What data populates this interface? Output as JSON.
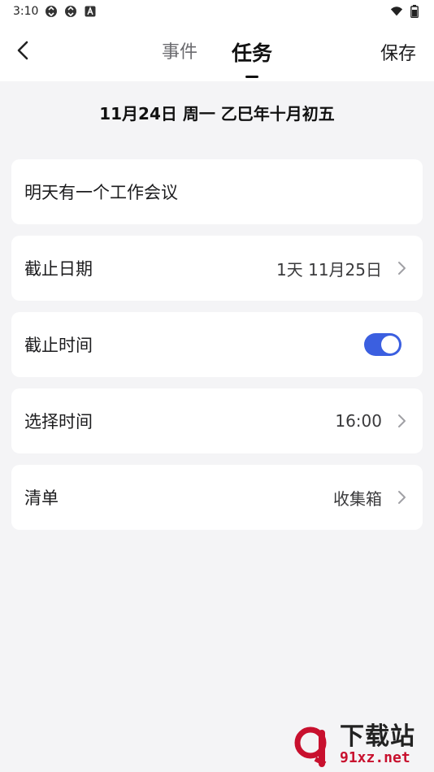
{
  "status_bar": {
    "time": "3:10",
    "icons": [
      "sync-icon",
      "sync-icon",
      "a-icon"
    ],
    "right_icons": [
      "wifi-icon",
      "battery-icon"
    ]
  },
  "header": {
    "tabs": [
      {
        "label": "事件",
        "active": false
      },
      {
        "label": "任务",
        "active": true
      }
    ],
    "save_label": "保存"
  },
  "date_line": "11月24日 周一 乙巳年十月初五",
  "task": {
    "title_value": "明天有一个工作会议"
  },
  "rows": {
    "deadline_date": {
      "label": "截止日期",
      "value": "1天 11月25日"
    },
    "deadline_time": {
      "label": "截止时间",
      "enabled": true
    },
    "select_time": {
      "label": "选择时间",
      "value": "16:00"
    },
    "list": {
      "label": "清单",
      "value": "收集箱"
    }
  },
  "watermark": {
    "cn": "下载站",
    "url": "91xz.net"
  },
  "colors": {
    "accent": "#3b5fe0",
    "background": "#f4f4f6",
    "card": "#ffffff"
  }
}
